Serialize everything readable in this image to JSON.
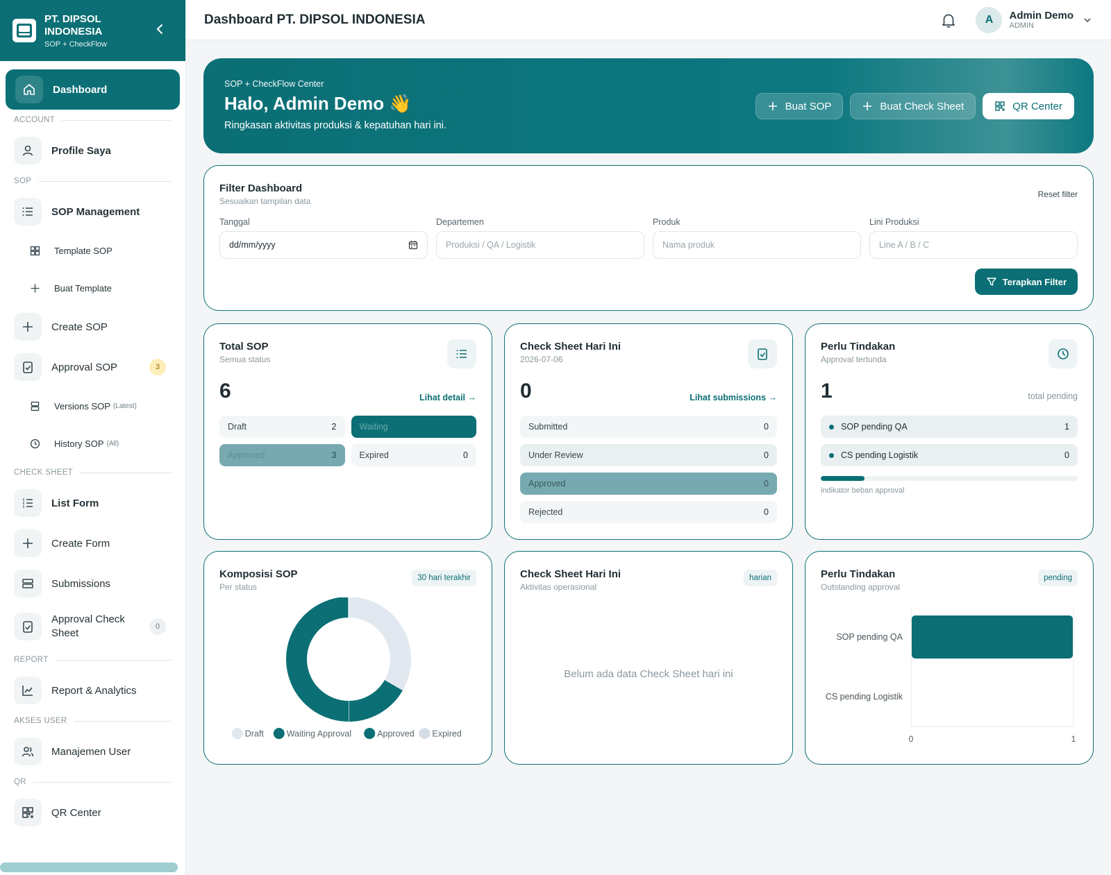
{
  "brand": {
    "name": "PT. DIPSOL INDONESIA",
    "name_line1": "PT. DIPSOL",
    "name_line2": "INDONESIA",
    "tagline": "SOP + CheckFlow"
  },
  "sidebar": {
    "dashboard": "Dashboard",
    "sections": {
      "account": "ACCOUNT",
      "sop": "SOP",
      "check_sheet": "CHECK SHEET",
      "report": "REPORT",
      "akses_user": "AKSES USER",
      "qr": "QR"
    },
    "items": {
      "profile": "Profile Saya",
      "sop_management": "SOP Management",
      "template_sop": "Template SOP",
      "buat_template": "Buat Template",
      "create_sop": "Create SOP",
      "approval_sop": "Approval SOP",
      "approval_sop_badge": "3",
      "versions_sop": "Versions SOP",
      "versions_sop_note": "(Latest)",
      "history_sop": "History SOP",
      "history_sop_note": "(All)",
      "list_form": "List Form",
      "create_form": "Create Form",
      "submissions": "Submissions",
      "approval_cs_l1": "Approval Check",
      "approval_cs_l2": "Sheet",
      "approval_cs_badge": "0",
      "report": "Report & Analytics",
      "manajemen_user": "Manajemen User",
      "qr_center": "QR Center"
    }
  },
  "header": {
    "title": "Dashboard PT. DIPSOL INDONESIA",
    "user_initial": "A",
    "user_name": "Admin Demo",
    "user_role": "ADMIN"
  },
  "hero": {
    "kicker": "SOP + CheckFlow Center",
    "greeting": "Halo, Admin Demo",
    "emoji": "👋",
    "subtitle": "Ringkasan aktivitas produksi & kepatuhan hari ini.",
    "btn_buat_sop": "Buat SOP",
    "btn_buat_cs": "Buat Check Sheet",
    "btn_qr": "QR Center"
  },
  "filter": {
    "title": "Filter Dashboard",
    "subtitle": "Sesuaikan tampilan data",
    "reset": "Reset filter",
    "tanggal_label": "Tanggal",
    "tanggal_value": "dd/mm/yyyy",
    "departemen_label": "Departemen",
    "departemen_placeholder": "Produksi / QA / Logistik",
    "produk_label": "Produk",
    "produk_placeholder": "Nama produk",
    "lini_label": "Lini Produksi",
    "lini_placeholder": "Line A / B / C",
    "apply": "Terapkan Filter"
  },
  "total_sop": {
    "title": "Total SOP",
    "subtitle": "Semua status",
    "value": "6",
    "link": "Lihat detail →",
    "draft_label": "Draft",
    "draft_value": "2",
    "waiting_label": "Waiting",
    "waiting_value": "",
    "approved_label": "Approved",
    "approved_value": "3",
    "expired_label": "Expired",
    "expired_value": "0"
  },
  "cs_today": {
    "title": "Check Sheet Hari Ini",
    "subtitle": "2026-07-06",
    "value": "0",
    "link": "Lihat submissions →",
    "rows": [
      {
        "label": "Submitted",
        "value": "0"
      },
      {
        "label": "Under Review",
        "value": "0"
      },
      {
        "label": "Approved",
        "value": "0"
      },
      {
        "label": "Rejected",
        "value": "0"
      }
    ]
  },
  "perlu": {
    "title": "Perlu Tindakan",
    "subtitle": "Approval tertunda",
    "value": "1",
    "note": "total pending",
    "rows": [
      {
        "label": "SOP pending QA",
        "value": "1"
      },
      {
        "label": "CS pending Logistik",
        "value": "0"
      }
    ],
    "indicator_label": "indikator beban approval",
    "indicator_fraction": 0.17
  },
  "komposisi": {
    "title": "Komposisi SOP",
    "subtitle": "Per status",
    "tag": "30 hari terakhir"
  },
  "cs_chart": {
    "title": "Check Sheet Hari Ini",
    "subtitle": "Aktivitas operasional",
    "tag": "harian",
    "empty": "Belum ada data Check Sheet hari ini"
  },
  "perlu_chart": {
    "title": "Perlu Tindakan",
    "subtitle": "Outstanding approval",
    "tag": "pending"
  },
  "colors": {
    "primary": "#0b6f75",
    "light": "#e2e8ef",
    "mid": "#77aab0"
  },
  "chart_data": [
    {
      "type": "pie",
      "categories": [
        "Draft",
        "Waiting Approval",
        "Approved",
        "Expired"
      ],
      "values": [
        2,
        1,
        3,
        0
      ],
      "colors": [
        "#e2e8ef",
        "#0b6f75",
        "#0b6f75",
        "#d5dde6"
      ],
      "legend": "bottom"
    },
    {
      "type": "bar",
      "orientation": "horizontal",
      "categories": [
        "SOP pending QA",
        "CS pending Logistik"
      ],
      "values": [
        1,
        0
      ],
      "xlim": [
        0,
        1
      ],
      "xticks": [
        "0",
        "1"
      ]
    }
  ]
}
